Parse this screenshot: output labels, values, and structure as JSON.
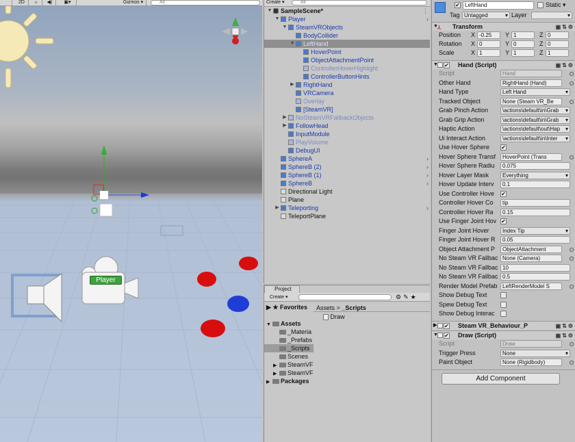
{
  "scene": {
    "toolbar": {
      "mode_2d": "2D",
      "gizmos": "Gizmos ▾",
      "search": "All"
    },
    "player_label": "Player"
  },
  "hierarchy": {
    "create": "Create ▾",
    "search": "All",
    "items": [
      {
        "label": "SampleScene*",
        "depth": 0,
        "style": "bold",
        "expand": "▼"
      },
      {
        "label": "Player",
        "depth": 1,
        "style": "prefab",
        "expand": "▼"
      },
      {
        "label": "SteamVRObjects",
        "depth": 2,
        "style": "prefab",
        "expand": "▼"
      },
      {
        "label": "BodyCollider",
        "depth": 3,
        "style": "prefab",
        "expand": ""
      },
      {
        "label": "LeftHand",
        "depth": 3,
        "style": "prefab-sel",
        "expand": "▼"
      },
      {
        "label": "HoverPoint",
        "depth": 4,
        "style": "prefab",
        "expand": ""
      },
      {
        "label": "ObjectAttachmentPoint",
        "depth": 4,
        "style": "prefab",
        "expand": ""
      },
      {
        "label": "ControllerHoverHighlight",
        "depth": 4,
        "style": "prefab-dim",
        "expand": ""
      },
      {
        "label": "ControllerButtonHints",
        "depth": 4,
        "style": "prefab",
        "expand": ""
      },
      {
        "label": "RightHand",
        "depth": 3,
        "style": "prefab",
        "expand": "▶"
      },
      {
        "label": "VRCamera",
        "depth": 3,
        "style": "prefab",
        "expand": ""
      },
      {
        "label": "Overlay",
        "depth": 3,
        "style": "prefab-dim",
        "expand": ""
      },
      {
        "label": "[SteamVR]",
        "depth": 3,
        "style": "prefab",
        "expand": ""
      },
      {
        "label": "NoSteamVRFallbackObjects",
        "depth": 2,
        "style": "prefab-dim",
        "expand": "▶"
      },
      {
        "label": "FollowHead",
        "depth": 2,
        "style": "prefab",
        "expand": "▶"
      },
      {
        "label": "InputModule",
        "depth": 2,
        "style": "prefab",
        "expand": ""
      },
      {
        "label": "PlayVolume",
        "depth": 2,
        "style": "prefab-dim",
        "expand": ""
      },
      {
        "label": "DebugUI",
        "depth": 2,
        "style": "prefab",
        "expand": ""
      },
      {
        "label": "SphereA",
        "depth": 1,
        "style": "prefab-more",
        "expand": ""
      },
      {
        "label": "SphereB (2)",
        "depth": 1,
        "style": "prefab-more",
        "expand": ""
      },
      {
        "label": "SphereB (1)",
        "depth": 1,
        "style": "prefab-more",
        "expand": ""
      },
      {
        "label": "SphereB",
        "depth": 1,
        "style": "prefab-more",
        "expand": ""
      },
      {
        "label": "Directional Light",
        "depth": 1,
        "style": "plain",
        "expand": ""
      },
      {
        "label": "Plane",
        "depth": 1,
        "style": "plain",
        "expand": ""
      },
      {
        "label": "Teleporting",
        "depth": 1,
        "style": "prefab-more",
        "expand": "▶"
      },
      {
        "label": "TeleportPlane",
        "depth": 1,
        "style": "plain",
        "expand": ""
      }
    ]
  },
  "project": {
    "tab": "Project",
    "create": "Create ▾",
    "favorites": "Favorites",
    "breadcrumb": [
      "Assets",
      ">",
      "_Scripts"
    ],
    "tree": [
      {
        "label": "Assets",
        "depth": 0,
        "bold": true,
        "expand": "▼"
      },
      {
        "label": "_Materia",
        "depth": 1,
        "expand": ""
      },
      {
        "label": "_Prefabs",
        "depth": 1,
        "expand": ""
      },
      {
        "label": "_Scripts",
        "depth": 1,
        "expand": "",
        "selected": true
      },
      {
        "label": "Scenes",
        "depth": 1,
        "expand": ""
      },
      {
        "label": "SteamVF",
        "depth": 1,
        "expand": "▶"
      },
      {
        "label": "SteamVF",
        "depth": 1,
        "expand": "▶"
      },
      {
        "label": "Packages",
        "depth": 0,
        "bold": true,
        "expand": "▶"
      }
    ],
    "files": [
      "Draw"
    ]
  },
  "inspector": {
    "object_name": "LeftHand",
    "static_label": "Static",
    "tag_label": "Tag",
    "tag_value": "Untagged",
    "layer_label": "Layer",
    "layer_value": "",
    "transform": {
      "title": "Transform",
      "rows": [
        {
          "label": "Position",
          "x": "-0.25",
          "y": "1",
          "z": "0"
        },
        {
          "label": "Rotation",
          "x": "0",
          "y": "0",
          "z": "0"
        },
        {
          "label": "Scale",
          "x": "1",
          "y": "1",
          "z": "1"
        }
      ]
    },
    "hand": {
      "title": "Hand (Script)",
      "rows": [
        {
          "label": "Script",
          "value": "Hand",
          "kind": "script"
        },
        {
          "label": "Other Hand",
          "value": "RightHand (Hand)",
          "kind": "obj"
        },
        {
          "label": "Hand Type",
          "value": "Left Hand",
          "kind": "drop"
        },
        {
          "label": "Tracked Object",
          "value": "None (Steam VR_Be",
          "kind": "obj"
        },
        {
          "label": "Grab Pinch Action",
          "value": "\\actions\\default\\in\\Grab",
          "kind": "drop"
        },
        {
          "label": "Grab Grip Action",
          "value": "\\actions\\default\\in\\Grab",
          "kind": "drop"
        },
        {
          "label": "Haptic Action",
          "value": "\\actions\\default\\out\\Hap",
          "kind": "drop"
        },
        {
          "label": "Ui Interact Action",
          "value": "\\actions\\default\\in\\Inter",
          "kind": "drop"
        },
        {
          "label": "Use Hover Sphere",
          "value": "✔",
          "kind": "check"
        },
        {
          "label": "Hover Sphere Transf",
          "value": "HoverPoint (Trans",
          "kind": "obj"
        },
        {
          "label": "Hover Sphere Radiu",
          "value": "0.075",
          "kind": "text"
        },
        {
          "label": "Hover Layer Mask",
          "value": "Everything",
          "kind": "drop"
        },
        {
          "label": "Hover Update Interv",
          "value": "0.1",
          "kind": "text"
        },
        {
          "label": "Use Controller Hove",
          "value": "✔",
          "kind": "check"
        },
        {
          "label": "Controller Hover Co",
          "value": "tip",
          "kind": "text"
        },
        {
          "label": "Controller Hover Ra",
          "value": "0.15",
          "kind": "text"
        },
        {
          "label": "Use Finger Joint Hov",
          "value": "✔",
          "kind": "check"
        },
        {
          "label": "Finger Joint Hover",
          "value": "Index Tip",
          "kind": "drop"
        },
        {
          "label": "Finger Joint Hover R",
          "value": "0.05",
          "kind": "text"
        },
        {
          "label": "Object Attachment P",
          "value": "ObjectAttachment",
          "kind": "obj"
        },
        {
          "label": "No Steam VR Fallbac",
          "value": "None (Camera)",
          "kind": "obj"
        },
        {
          "label": "No Steam VR Fallbac",
          "value": "10",
          "kind": "text"
        },
        {
          "label": "No Steam VR Fallbac",
          "value": "0.5",
          "kind": "text"
        },
        {
          "label": "Render Model Prefab",
          "value": "LeftRenderModel S",
          "kind": "obj"
        },
        {
          "label": "Show Debug Text",
          "value": "",
          "kind": "check"
        },
        {
          "label": "Spew Debug Text",
          "value": "",
          "kind": "check"
        },
        {
          "label": "Show Debug Interac",
          "value": "",
          "kind": "check"
        }
      ]
    },
    "steamvr_behaviour": {
      "title": "Steam VR_Behaviour_P"
    },
    "draw": {
      "title": "Draw (Script)",
      "rows": [
        {
          "label": "Script",
          "value": "Draw",
          "kind": "script"
        },
        {
          "label": "Trigger Press",
          "value": "None",
          "kind": "drop"
        },
        {
          "label": "Paint Object",
          "value": "None (Rigidbody)",
          "kind": "obj"
        }
      ]
    },
    "add_component": "Add Component"
  }
}
